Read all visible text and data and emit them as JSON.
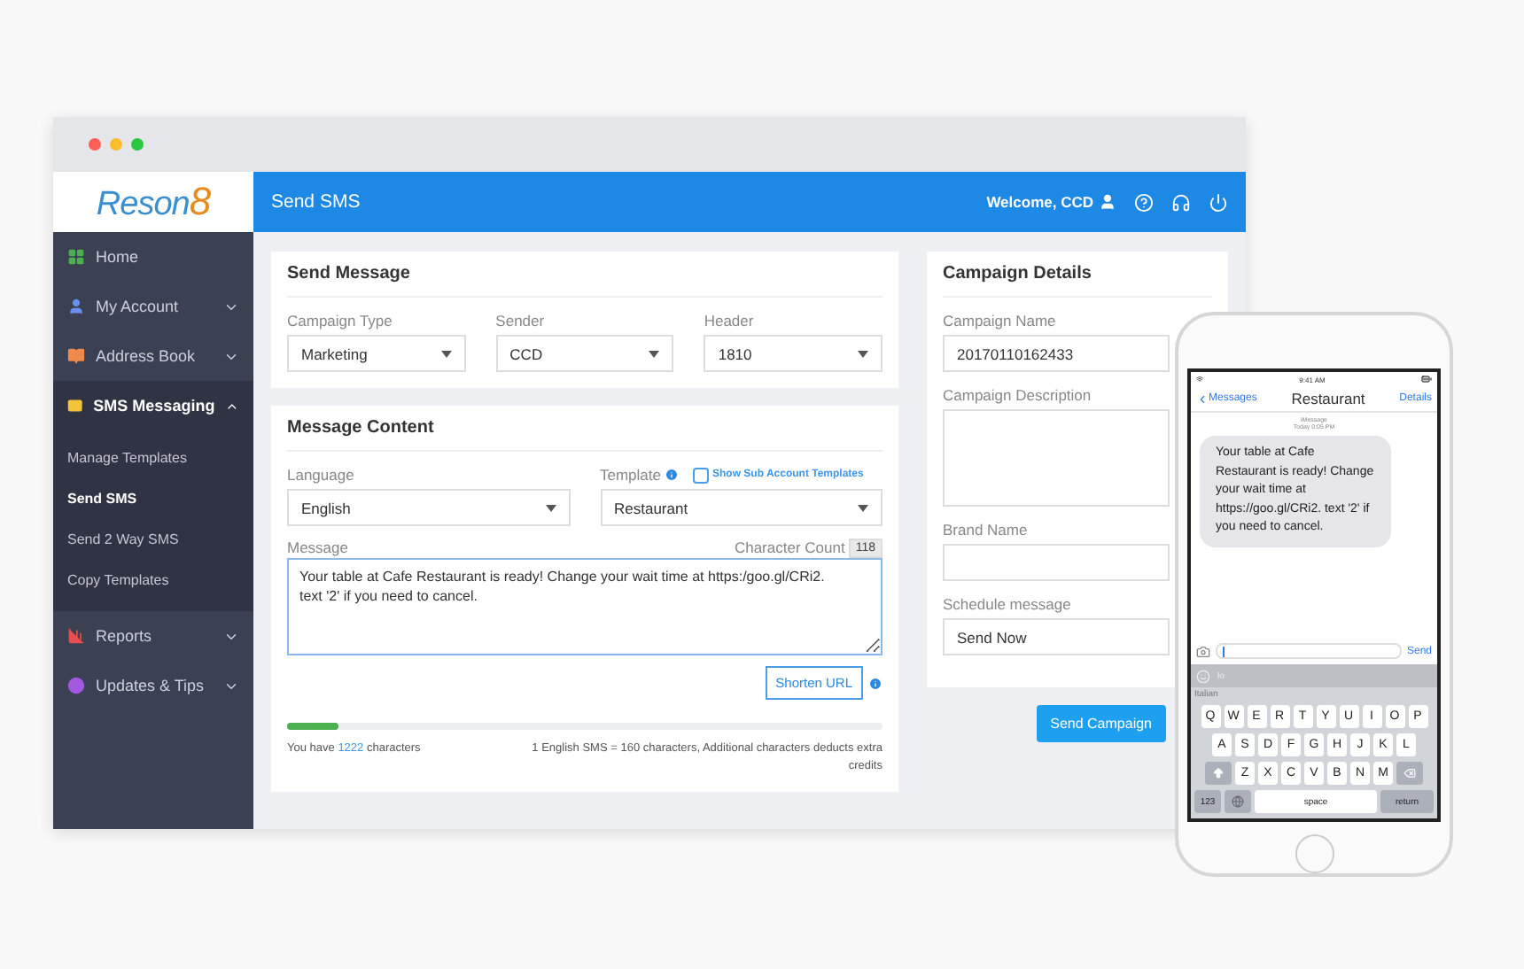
{
  "window": {
    "logo": "Reson8",
    "header_title": "Send SMS",
    "welcome": "Welcome, CCD"
  },
  "sidebar": {
    "items": [
      {
        "label": "Home",
        "kind": "link"
      },
      {
        "label": "My Account",
        "kind": "group",
        "expanded": false
      },
      {
        "label": "Address Book",
        "kind": "group",
        "expanded": false
      },
      {
        "label": "SMS Messaging",
        "kind": "group",
        "expanded": true,
        "children": [
          {
            "label": "Manage Templates",
            "selected": false
          },
          {
            "label": "Send SMS",
            "selected": true
          },
          {
            "label": "Send 2 Way SMS",
            "selected": false
          },
          {
            "label": "Copy Templates",
            "selected": false
          }
        ]
      },
      {
        "label": "Reports",
        "kind": "group",
        "expanded": false
      },
      {
        "label": "Updates & Tips",
        "kind": "group",
        "expanded": false
      }
    ]
  },
  "send_message": {
    "title": "Send Message",
    "fields": [
      {
        "label": "Campaign Type",
        "value": "Marketing"
      },
      {
        "label": "Sender",
        "value": "CCD"
      },
      {
        "label": "Header",
        "value": "1810"
      }
    ]
  },
  "message_content": {
    "title": "Message Content",
    "language": {
      "label": "Language",
      "value": "English"
    },
    "template": {
      "label": "Template",
      "value": "Restaurant",
      "sub_account_label": "Show Sub Account Templates",
      "sub_account_checked": false
    },
    "message": {
      "label": "Message",
      "count_label": "Character Count",
      "count": "118",
      "value": "Your table at Cafe Restaurant is ready! Change your wait time at https:/goo.gl/CRi2.\ntext '2' if you need to cancel."
    },
    "shorten_button": "Shorten URL",
    "progress": {
      "level": 0.085
    },
    "remaining": "You have **1222** characters",
    "note": "1 English SMS = 160 characters, Additional characters deducts extra credits"
  },
  "campaign_details": {
    "title": "Campaign Details",
    "fields": [
      {
        "label": "Campaign Name",
        "kind": "text",
        "value": "20170110162433"
      },
      {
        "label": "Campaign Description",
        "kind": "textarea"
      },
      {
        "label": "Brand Name",
        "kind": "text"
      },
      {
        "label": "Schedule message",
        "kind": "select",
        "value": "Send Now"
      }
    ],
    "send_button": "Send Campaign"
  },
  "phone": {
    "time": "9:41 AM",
    "back": "Messages",
    "contact": "Restaurant",
    "details": "Details",
    "service": "iMessage",
    "timestamp": "Today 0:05 PM",
    "bubble": "Your table at Cafe Restaurant is ready! Change your wait time at https://goo.gl/CRi2. text '2' if you need to cancel.",
    "send": "Send",
    "suggestion": "lo",
    "keyboard_language": "Italian",
    "keys": [
      [
        "Q",
        "W",
        "E",
        "R",
        "T",
        "Y",
        "U",
        "I",
        "O",
        "P"
      ],
      [
        "A",
        "S",
        "D",
        "F",
        "G",
        "H",
        "J",
        "K",
        "L"
      ],
      [
        "Z",
        "X",
        "C",
        "V",
        "B",
        "N",
        "M"
      ]
    ],
    "bottom_keys": [
      "123",
      "space",
      "return"
    ]
  }
}
